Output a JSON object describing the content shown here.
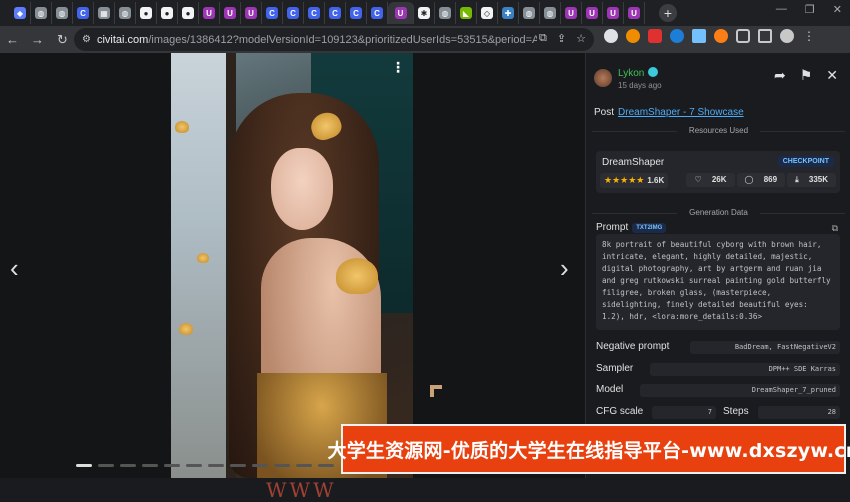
{
  "browser": {
    "url_host": "civitai.com",
    "url_path": "/images/1386412?modelVersionId=109123&prioritizedUserIds=53515&period=AllTime&sor...",
    "tabs": [
      {
        "icon": "gem-icon",
        "color": "#5c7cfa"
      },
      {
        "icon": "globe-icon",
        "color": "#868e96"
      },
      {
        "icon": "globe-icon",
        "color": "#868e96"
      },
      {
        "icon": "c-icon",
        "color": "#4263eb"
      },
      {
        "icon": "app-icon",
        "color": "#868e96"
      },
      {
        "icon": "globe-icon",
        "color": "#868e96"
      },
      {
        "icon": "github-icon",
        "color": "#f1f3f5"
      },
      {
        "icon": "github-icon",
        "color": "#f1f3f5"
      },
      {
        "icon": "github-icon",
        "color": "#f1f3f5"
      },
      {
        "icon": "u-icon",
        "color": "#9c36b5"
      },
      {
        "icon": "u-icon",
        "color": "#9c36b5"
      },
      {
        "icon": "u-icon",
        "color": "#9c36b5"
      },
      {
        "icon": "c-icon",
        "color": "#4263eb"
      },
      {
        "icon": "c-icon",
        "color": "#4263eb"
      },
      {
        "icon": "c-icon",
        "color": "#4263eb"
      },
      {
        "icon": "c-icon",
        "color": "#4263eb"
      },
      {
        "icon": "c-icon",
        "color": "#4263eb"
      },
      {
        "icon": "c-icon",
        "color": "#4263eb"
      },
      {
        "icon": "u-icon",
        "color": "#9c36b5",
        "active": true
      },
      {
        "icon": "gear-icon",
        "color": "#f1f3f5"
      },
      {
        "icon": "globe-icon",
        "color": "#868e96"
      },
      {
        "icon": "nvidia-icon",
        "color": "#76b900"
      },
      {
        "icon": "git-icon",
        "color": "#f1f3f5"
      },
      {
        "icon": "python-icon",
        "color": "#3b82c4"
      },
      {
        "icon": "globe-icon",
        "color": "#868e96"
      },
      {
        "icon": "globe-icon",
        "color": "#868e96"
      },
      {
        "icon": "u-icon",
        "color": "#9c36b5"
      },
      {
        "icon": "u-icon",
        "color": "#9c36b5"
      },
      {
        "icon": "u-icon",
        "color": "#9c36b5"
      },
      {
        "icon": "u-icon",
        "color": "#9c36b5"
      }
    ]
  },
  "user": {
    "name": "Lykon",
    "date": "15 days ago"
  },
  "post": {
    "label": "Post",
    "link": "DreamShaper - 7 Showcase"
  },
  "resources_label": "Resources Used",
  "resource": {
    "name": "DreamShaper",
    "badge": "CHECKPOINT",
    "stars": "★★★★★",
    "rating_count": "1.6K",
    "likes": "26K",
    "comments": "869",
    "downloads": "335K"
  },
  "generation_label": "Generation Data",
  "prompt": {
    "label": "Prompt",
    "tag": "TXT2IMG",
    "text": "8k portrait of beautiful cyborg with brown hair, intricate, elegant, highly detailed, majestic, digital photography, art by artgerm and ruan jia and greg rutkowski surreal painting gold butterfly filigree, broken glass, (masterpiece, sidelighting, finely detailed beautiful eyes: 1.2), hdr, <lora:more_details:0.36>"
  },
  "params": {
    "negative_label": "Negative prompt",
    "negative": "BadDream, FastNegativeV2",
    "sampler_label": "Sampler",
    "sampler": "DPM++ SDE Karras",
    "model_label": "Model",
    "model": "DreamShaper_7_pruned",
    "cfg_label": "CFG scale",
    "cfg": "7",
    "steps_label": "Steps",
    "steps": "28"
  },
  "banner_text": "大学生资源网-优质的大学生在线指导平台-www.dxszyw.cn",
  "watermark": "WWW"
}
